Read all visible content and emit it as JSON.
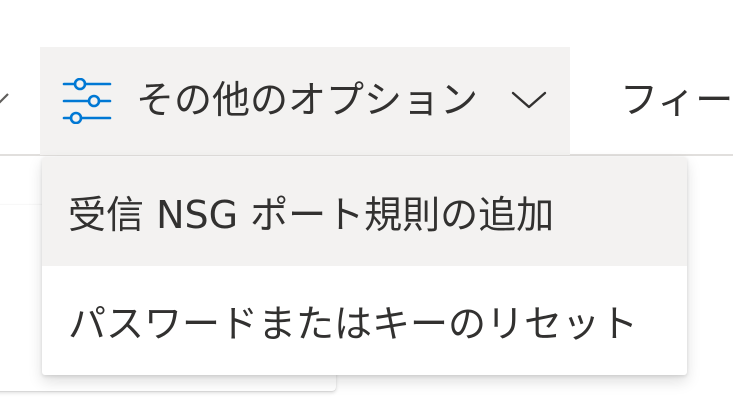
{
  "toolbar": {
    "more_options": {
      "label": "その他のオプション",
      "icon": "sliders-icon",
      "chevron": "chevron-down-icon"
    },
    "filter_label": "フィー"
  },
  "menu": {
    "items": [
      {
        "label": "受信 NSG ポート規則の追加"
      },
      {
        "label": "パスワードまたはキーのリセット"
      }
    ]
  },
  "colors": {
    "accent": "#0078d4",
    "button_bg": "#f3f2f1",
    "text": "#323130",
    "divider": "#e1dfdd"
  }
}
